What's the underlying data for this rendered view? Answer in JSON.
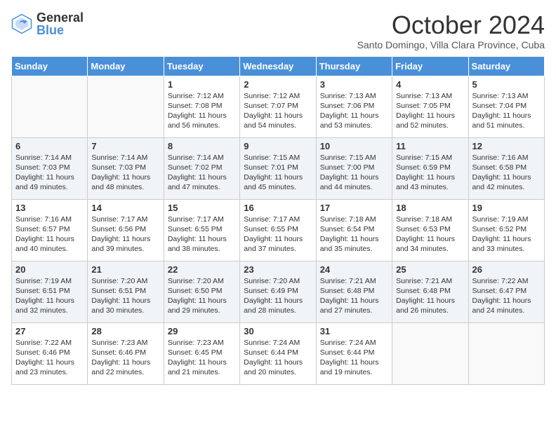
{
  "logo": {
    "general": "General",
    "blue": "Blue"
  },
  "header": {
    "month": "October 2024",
    "location": "Santo Domingo, Villa Clara Province, Cuba"
  },
  "weekdays": [
    "Sunday",
    "Monday",
    "Tuesday",
    "Wednesday",
    "Thursday",
    "Friday",
    "Saturday"
  ],
  "weeks": [
    [
      {
        "day": "",
        "info": ""
      },
      {
        "day": "",
        "info": ""
      },
      {
        "day": "1",
        "info": "Sunrise: 7:12 AM\nSunset: 7:08 PM\nDaylight: 11 hours and 56 minutes."
      },
      {
        "day": "2",
        "info": "Sunrise: 7:12 AM\nSunset: 7:07 PM\nDaylight: 11 hours and 54 minutes."
      },
      {
        "day": "3",
        "info": "Sunrise: 7:13 AM\nSunset: 7:06 PM\nDaylight: 11 hours and 53 minutes."
      },
      {
        "day": "4",
        "info": "Sunrise: 7:13 AM\nSunset: 7:05 PM\nDaylight: 11 hours and 52 minutes."
      },
      {
        "day": "5",
        "info": "Sunrise: 7:13 AM\nSunset: 7:04 PM\nDaylight: 11 hours and 51 minutes."
      }
    ],
    [
      {
        "day": "6",
        "info": "Sunrise: 7:14 AM\nSunset: 7:03 PM\nDaylight: 11 hours and 49 minutes."
      },
      {
        "day": "7",
        "info": "Sunrise: 7:14 AM\nSunset: 7:03 PM\nDaylight: 11 hours and 48 minutes."
      },
      {
        "day": "8",
        "info": "Sunrise: 7:14 AM\nSunset: 7:02 PM\nDaylight: 11 hours and 47 minutes."
      },
      {
        "day": "9",
        "info": "Sunrise: 7:15 AM\nSunset: 7:01 PM\nDaylight: 11 hours and 45 minutes."
      },
      {
        "day": "10",
        "info": "Sunrise: 7:15 AM\nSunset: 7:00 PM\nDaylight: 11 hours and 44 minutes."
      },
      {
        "day": "11",
        "info": "Sunrise: 7:15 AM\nSunset: 6:59 PM\nDaylight: 11 hours and 43 minutes."
      },
      {
        "day": "12",
        "info": "Sunrise: 7:16 AM\nSunset: 6:58 PM\nDaylight: 11 hours and 42 minutes."
      }
    ],
    [
      {
        "day": "13",
        "info": "Sunrise: 7:16 AM\nSunset: 6:57 PM\nDaylight: 11 hours and 40 minutes."
      },
      {
        "day": "14",
        "info": "Sunrise: 7:17 AM\nSunset: 6:56 PM\nDaylight: 11 hours and 39 minutes."
      },
      {
        "day": "15",
        "info": "Sunrise: 7:17 AM\nSunset: 6:55 PM\nDaylight: 11 hours and 38 minutes."
      },
      {
        "day": "16",
        "info": "Sunrise: 7:17 AM\nSunset: 6:55 PM\nDaylight: 11 hours and 37 minutes."
      },
      {
        "day": "17",
        "info": "Sunrise: 7:18 AM\nSunset: 6:54 PM\nDaylight: 11 hours and 35 minutes."
      },
      {
        "day": "18",
        "info": "Sunrise: 7:18 AM\nSunset: 6:53 PM\nDaylight: 11 hours and 34 minutes."
      },
      {
        "day": "19",
        "info": "Sunrise: 7:19 AM\nSunset: 6:52 PM\nDaylight: 11 hours and 33 minutes."
      }
    ],
    [
      {
        "day": "20",
        "info": "Sunrise: 7:19 AM\nSunset: 6:51 PM\nDaylight: 11 hours and 32 minutes."
      },
      {
        "day": "21",
        "info": "Sunrise: 7:20 AM\nSunset: 6:51 PM\nDaylight: 11 hours and 30 minutes."
      },
      {
        "day": "22",
        "info": "Sunrise: 7:20 AM\nSunset: 6:50 PM\nDaylight: 11 hours and 29 minutes."
      },
      {
        "day": "23",
        "info": "Sunrise: 7:20 AM\nSunset: 6:49 PM\nDaylight: 11 hours and 28 minutes."
      },
      {
        "day": "24",
        "info": "Sunrise: 7:21 AM\nSunset: 6:48 PM\nDaylight: 11 hours and 27 minutes."
      },
      {
        "day": "25",
        "info": "Sunrise: 7:21 AM\nSunset: 6:48 PM\nDaylight: 11 hours and 26 minutes."
      },
      {
        "day": "26",
        "info": "Sunrise: 7:22 AM\nSunset: 6:47 PM\nDaylight: 11 hours and 24 minutes."
      }
    ],
    [
      {
        "day": "27",
        "info": "Sunrise: 7:22 AM\nSunset: 6:46 PM\nDaylight: 11 hours and 23 minutes."
      },
      {
        "day": "28",
        "info": "Sunrise: 7:23 AM\nSunset: 6:46 PM\nDaylight: 11 hours and 22 minutes."
      },
      {
        "day": "29",
        "info": "Sunrise: 7:23 AM\nSunset: 6:45 PM\nDaylight: 11 hours and 21 minutes."
      },
      {
        "day": "30",
        "info": "Sunrise: 7:24 AM\nSunset: 6:44 PM\nDaylight: 11 hours and 20 minutes."
      },
      {
        "day": "31",
        "info": "Sunrise: 7:24 AM\nSunset: 6:44 PM\nDaylight: 11 hours and 19 minutes."
      },
      {
        "day": "",
        "info": ""
      },
      {
        "day": "",
        "info": ""
      }
    ]
  ]
}
